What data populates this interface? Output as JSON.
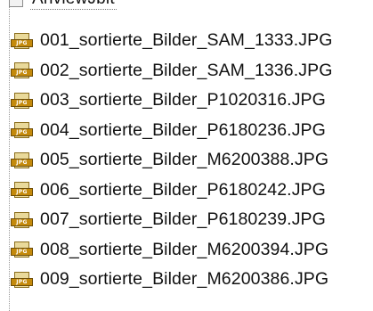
{
  "tree": {
    "parent_folder": {
      "label": "AnviewJbit"
    }
  },
  "file_icon": {
    "name": "jpg-file-icon",
    "badge_text": "JPG",
    "colors": {
      "paper": "#e9d99a",
      "band": "#c48a0c"
    }
  },
  "files": [
    {
      "name": "001_sortierte_Bilder_SAM_1333.JPG"
    },
    {
      "name": "002_sortierte_Bilder_SAM_1336.JPG"
    },
    {
      "name": "003_sortierte_Bilder_P1020316.JPG"
    },
    {
      "name": "004_sortierte_Bilder_P6180236.JPG"
    },
    {
      "name": "005_sortierte_Bilder_M6200388.JPG"
    },
    {
      "name": "006_sortierte_Bilder_P6180242.JPG"
    },
    {
      "name": "007_sortierte_Bilder_P6180239.JPG"
    },
    {
      "name": "008_sortierte_Bilder_M6200394.JPG"
    },
    {
      "name": "009_sortierte_Bilder_M6200386.JPG"
    }
  ]
}
